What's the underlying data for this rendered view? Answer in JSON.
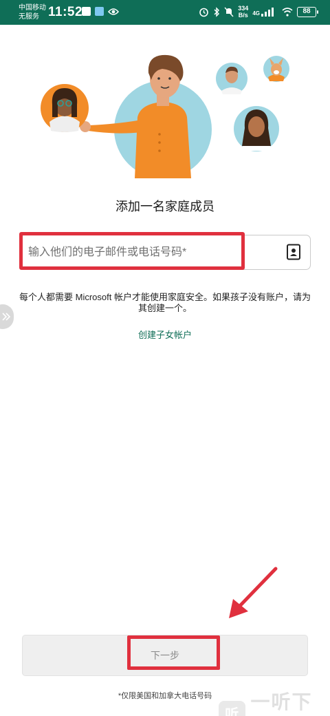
{
  "status_bar": {
    "carrier_line1": "中国移动",
    "carrier_line2": "无服务",
    "time": "11:52",
    "net_speed_value": "334",
    "net_speed_unit": "B/s",
    "signal_label": "4G",
    "battery": "88"
  },
  "page": {
    "title": "添加一名家庭成员",
    "email_placeholder": "输入他们的电子邮件或电话号码*",
    "info_text_line1": "每个人都需要 Microsoft 帐户才能使用家庭安全。如果孩子没有账户，请为",
    "info_text_line2": "其创建一个。",
    "create_child_link": "创建子女帐户",
    "next_button": "下一步",
    "footnote": "*仅限美国和加拿大电话号码"
  },
  "watermark": {
    "logo_char": "听",
    "text": "一听下载"
  },
  "colors": {
    "status_bar_bg": "#0f6e57",
    "accent_link": "#0f6e57",
    "highlight_red": "#e0303e",
    "avatar_orange": "#f28c28",
    "avatar_blue": "#9fd6e2"
  },
  "icons": {
    "contact_book": "contact-book-icon",
    "side_handle": "double-chevron-right-icon"
  }
}
